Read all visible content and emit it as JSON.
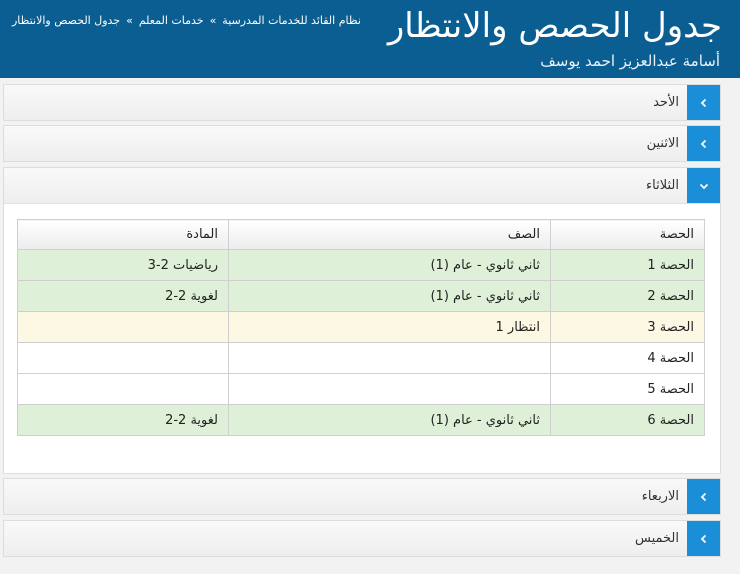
{
  "header": {
    "title": "جدول الحصص والانتظار",
    "user": "أسامة عبدالعزيز احمد يوسف",
    "breadcrumb": [
      "نظام القائد للخدمات المدرسية",
      "خدمات المعلم",
      "جدول الحصص والانتظار"
    ],
    "breadcrumb_sep": "»"
  },
  "days": [
    {
      "label": "الأحد",
      "expanded": false
    },
    {
      "label": "الاثنين",
      "expanded": false
    },
    {
      "label": "الثلاثاء",
      "expanded": true
    },
    {
      "label": "الاربعاء",
      "expanded": false
    },
    {
      "label": "الخميس",
      "expanded": false
    }
  ],
  "table": {
    "headers": {
      "period": "الحصة",
      "class": "الصف",
      "subject": "المادة"
    },
    "rows": [
      {
        "period": "الحصة 1",
        "class": "ثاني ثانوي - عام (1)",
        "subject": "رياضيات 2-3",
        "status": "assigned"
      },
      {
        "period": "الحصة 2",
        "class": "ثاني ثانوي - عام (1)",
        "subject": "لغوية 2-2",
        "status": "assigned"
      },
      {
        "period": "الحصة 3",
        "class": "انتظار 1",
        "subject": "",
        "status": "waiting"
      },
      {
        "period": "الحصة 4",
        "class": "",
        "subject": "",
        "status": "free"
      },
      {
        "period": "الحصة 5",
        "class": "",
        "subject": "",
        "status": "free"
      },
      {
        "period": "الحصة 6",
        "class": "ثاني ثانوي - عام (1)",
        "subject": "لغوية 2-2",
        "status": "assigned"
      }
    ]
  },
  "colors": {
    "header_bg": "#0b5e91",
    "toggle_bg": "#1a8fd8",
    "assigned_row": "#dff0d8",
    "waiting_row": "#fcf8e3"
  },
  "icons": {
    "collapsed": "chevron-left-icon",
    "expanded": "chevron-down-icon"
  }
}
